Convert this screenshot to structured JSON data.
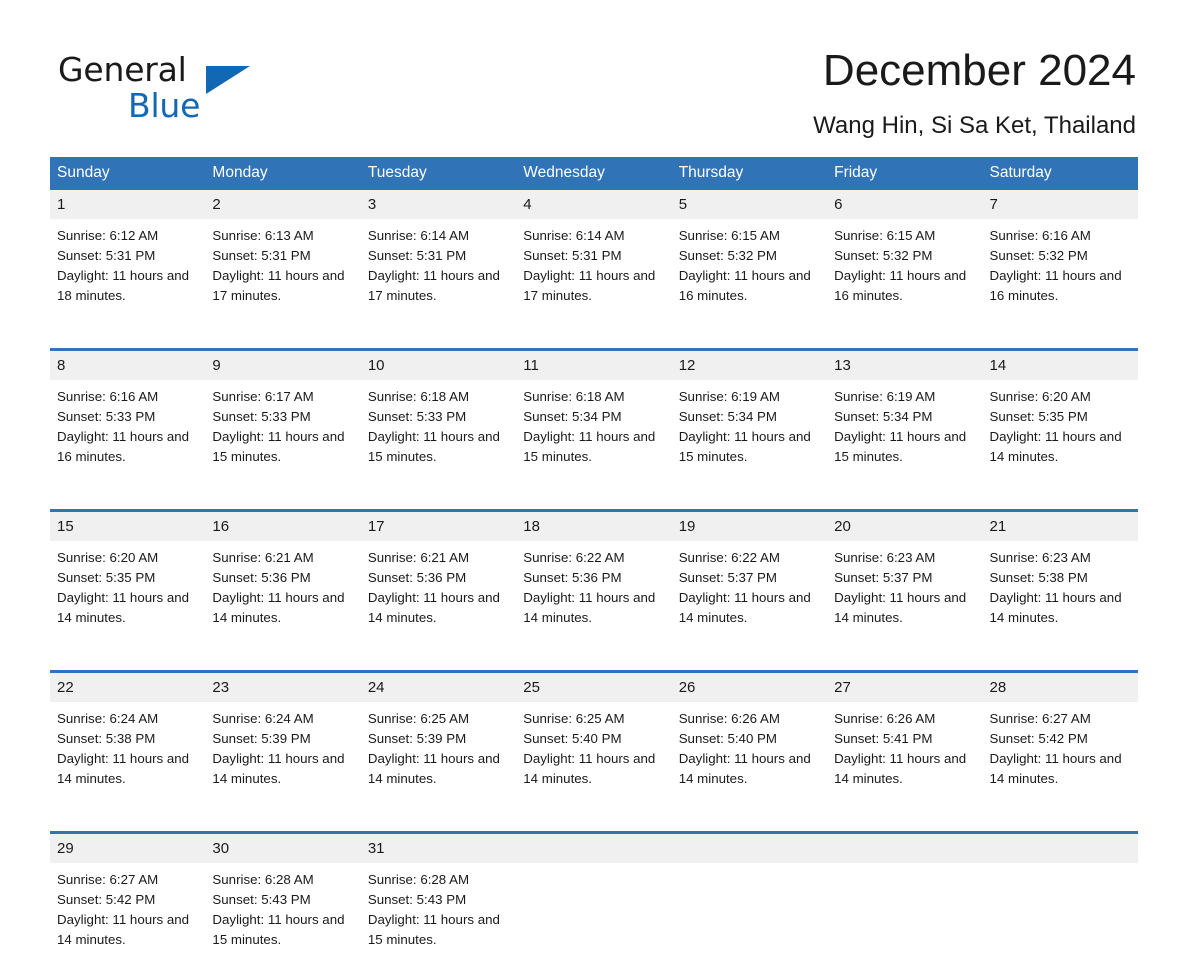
{
  "brand": {
    "name_line1": "General",
    "name_line2": "Blue",
    "accent_color": "#1268b3"
  },
  "header": {
    "month_title": "December 2024",
    "location": "Wang Hin, Si Sa Ket, Thailand"
  },
  "calendar": {
    "header_bg": "#3073b7",
    "daynum_bg": "#f0f0f0",
    "weekday_labels": [
      "Sunday",
      "Monday",
      "Tuesday",
      "Wednesday",
      "Thursday",
      "Friday",
      "Saturday"
    ],
    "weeks": [
      [
        {
          "day": "1",
          "sunrise": "Sunrise: 6:12 AM",
          "sunset": "Sunset: 5:31 PM",
          "daylight": "Daylight: 11 hours and 18 minutes."
        },
        {
          "day": "2",
          "sunrise": "Sunrise: 6:13 AM",
          "sunset": "Sunset: 5:31 PM",
          "daylight": "Daylight: 11 hours and 17 minutes."
        },
        {
          "day": "3",
          "sunrise": "Sunrise: 6:14 AM",
          "sunset": "Sunset: 5:31 PM",
          "daylight": "Daylight: 11 hours and 17 minutes."
        },
        {
          "day": "4",
          "sunrise": "Sunrise: 6:14 AM",
          "sunset": "Sunset: 5:31 PM",
          "daylight": "Daylight: 11 hours and 17 minutes."
        },
        {
          "day": "5",
          "sunrise": "Sunrise: 6:15 AM",
          "sunset": "Sunset: 5:32 PM",
          "daylight": "Daylight: 11 hours and 16 minutes."
        },
        {
          "day": "6",
          "sunrise": "Sunrise: 6:15 AM",
          "sunset": "Sunset: 5:32 PM",
          "daylight": "Daylight: 11 hours and 16 minutes."
        },
        {
          "day": "7",
          "sunrise": "Sunrise: 6:16 AM",
          "sunset": "Sunset: 5:32 PM",
          "daylight": "Daylight: 11 hours and 16 minutes."
        }
      ],
      [
        {
          "day": "8",
          "sunrise": "Sunrise: 6:16 AM",
          "sunset": "Sunset: 5:33 PM",
          "daylight": "Daylight: 11 hours and 16 minutes."
        },
        {
          "day": "9",
          "sunrise": "Sunrise: 6:17 AM",
          "sunset": "Sunset: 5:33 PM",
          "daylight": "Daylight: 11 hours and 15 minutes."
        },
        {
          "day": "10",
          "sunrise": "Sunrise: 6:18 AM",
          "sunset": "Sunset: 5:33 PM",
          "daylight": "Daylight: 11 hours and 15 minutes."
        },
        {
          "day": "11",
          "sunrise": "Sunrise: 6:18 AM",
          "sunset": "Sunset: 5:34 PM",
          "daylight": "Daylight: 11 hours and 15 minutes."
        },
        {
          "day": "12",
          "sunrise": "Sunrise: 6:19 AM",
          "sunset": "Sunset: 5:34 PM",
          "daylight": "Daylight: 11 hours and 15 minutes."
        },
        {
          "day": "13",
          "sunrise": "Sunrise: 6:19 AM",
          "sunset": "Sunset: 5:34 PM",
          "daylight": "Daylight: 11 hours and 15 minutes."
        },
        {
          "day": "14",
          "sunrise": "Sunrise: 6:20 AM",
          "sunset": "Sunset: 5:35 PM",
          "daylight": "Daylight: 11 hours and 14 minutes."
        }
      ],
      [
        {
          "day": "15",
          "sunrise": "Sunrise: 6:20 AM",
          "sunset": "Sunset: 5:35 PM",
          "daylight": "Daylight: 11 hours and 14 minutes."
        },
        {
          "day": "16",
          "sunrise": "Sunrise: 6:21 AM",
          "sunset": "Sunset: 5:36 PM",
          "daylight": "Daylight: 11 hours and 14 minutes."
        },
        {
          "day": "17",
          "sunrise": "Sunrise: 6:21 AM",
          "sunset": "Sunset: 5:36 PM",
          "daylight": "Daylight: 11 hours and 14 minutes."
        },
        {
          "day": "18",
          "sunrise": "Sunrise: 6:22 AM",
          "sunset": "Sunset: 5:36 PM",
          "daylight": "Daylight: 11 hours and 14 minutes."
        },
        {
          "day": "19",
          "sunrise": "Sunrise: 6:22 AM",
          "sunset": "Sunset: 5:37 PM",
          "daylight": "Daylight: 11 hours and 14 minutes."
        },
        {
          "day": "20",
          "sunrise": "Sunrise: 6:23 AM",
          "sunset": "Sunset: 5:37 PM",
          "daylight": "Daylight: 11 hours and 14 minutes."
        },
        {
          "day": "21",
          "sunrise": "Sunrise: 6:23 AM",
          "sunset": "Sunset: 5:38 PM",
          "daylight": "Daylight: 11 hours and 14 minutes."
        }
      ],
      [
        {
          "day": "22",
          "sunrise": "Sunrise: 6:24 AM",
          "sunset": "Sunset: 5:38 PM",
          "daylight": "Daylight: 11 hours and 14 minutes."
        },
        {
          "day": "23",
          "sunrise": "Sunrise: 6:24 AM",
          "sunset": "Sunset: 5:39 PM",
          "daylight": "Daylight: 11 hours and 14 minutes."
        },
        {
          "day": "24",
          "sunrise": "Sunrise: 6:25 AM",
          "sunset": "Sunset: 5:39 PM",
          "daylight": "Daylight: 11 hours and 14 minutes."
        },
        {
          "day": "25",
          "sunrise": "Sunrise: 6:25 AM",
          "sunset": "Sunset: 5:40 PM",
          "daylight": "Daylight: 11 hours and 14 minutes."
        },
        {
          "day": "26",
          "sunrise": "Sunrise: 6:26 AM",
          "sunset": "Sunset: 5:40 PM",
          "daylight": "Daylight: 11 hours and 14 minutes."
        },
        {
          "day": "27",
          "sunrise": "Sunrise: 6:26 AM",
          "sunset": "Sunset: 5:41 PM",
          "daylight": "Daylight: 11 hours and 14 minutes."
        },
        {
          "day": "28",
          "sunrise": "Sunrise: 6:27 AM",
          "sunset": "Sunset: 5:42 PM",
          "daylight": "Daylight: 11 hours and 14 minutes."
        }
      ],
      [
        {
          "day": "29",
          "sunrise": "Sunrise: 6:27 AM",
          "sunset": "Sunset: 5:42 PM",
          "daylight": "Daylight: 11 hours and 14 minutes."
        },
        {
          "day": "30",
          "sunrise": "Sunrise: 6:28 AM",
          "sunset": "Sunset: 5:43 PM",
          "daylight": "Daylight: 11 hours and 15 minutes."
        },
        {
          "day": "31",
          "sunrise": "Sunrise: 6:28 AM",
          "sunset": "Sunset: 5:43 PM",
          "daylight": "Daylight: 11 hours and 15 minutes."
        },
        {
          "day": "",
          "sunrise": "",
          "sunset": "",
          "daylight": ""
        },
        {
          "day": "",
          "sunrise": "",
          "sunset": "",
          "daylight": ""
        },
        {
          "day": "",
          "sunrise": "",
          "sunset": "",
          "daylight": ""
        },
        {
          "day": "",
          "sunrise": "",
          "sunset": "",
          "daylight": ""
        }
      ]
    ]
  }
}
